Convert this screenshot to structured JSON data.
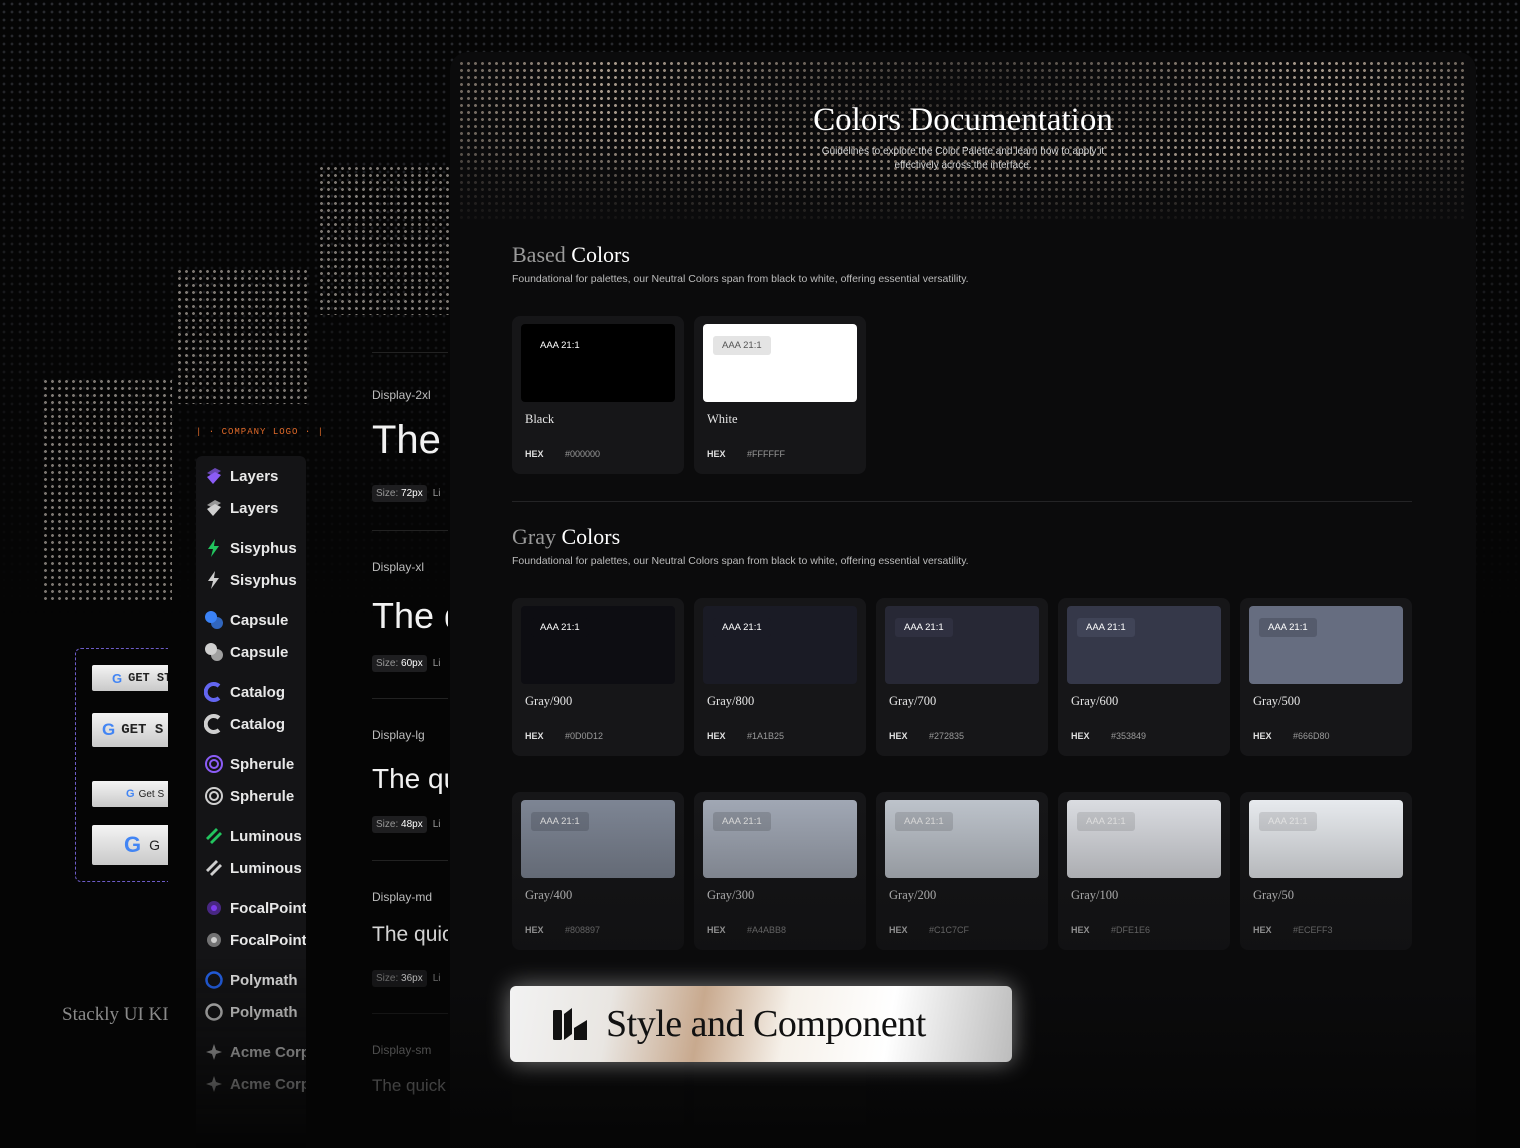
{
  "document": {
    "title": "Colors Documentation",
    "subtitle": "Guidelines to explore the Color Palette and learn how to apply it effectively across the interface."
  },
  "sections": {
    "based": {
      "title_light": "Based",
      "title_strong": "Colors",
      "description": "Foundational for palettes, our Neutral Colors span from black to white, offering essential versatility.",
      "colors": [
        {
          "name": "Black",
          "hex_label": "HEX",
          "hex": "#000000",
          "badge": "AAA 21:1",
          "swatch": "#000000",
          "badge_bg": "#000000",
          "badge_fg": "#ffffff"
        },
        {
          "name": "White",
          "hex_label": "HEX",
          "hex": "#FFFFFF",
          "badge": "AAA 21:1",
          "swatch": "#FFFFFF",
          "badge_bg": "#e4e4e4",
          "badge_fg": "#555555"
        }
      ]
    },
    "gray": {
      "title_light": "Gray",
      "title_strong": "Colors",
      "description": "Foundational for palettes, our Neutral Colors span from black to white, offering essential versatility.",
      "colors": [
        {
          "name": "Gray/900",
          "hex_label": "HEX",
          "hex": "#0D0D12",
          "badge": "AAA 21:1",
          "swatch": "#0D0D12",
          "badge_bg": "#0D0D12",
          "badge_fg": "#ffffff"
        },
        {
          "name": "Gray/800",
          "hex_label": "HEX",
          "hex": "#1A1B25",
          "badge": "AAA 21:1",
          "swatch": "#1A1B25",
          "badge_bg": "#1A1B25",
          "badge_fg": "#ffffff"
        },
        {
          "name": "Gray/700",
          "hex_label": "HEX",
          "hex": "#272835",
          "badge": "AAA 21:1",
          "swatch": "#272835",
          "badge_bg": "#2f3040",
          "badge_fg": "#ffffff"
        },
        {
          "name": "Gray/600",
          "hex_label": "HEX",
          "hex": "#353849",
          "badge": "AAA 21:1",
          "swatch": "#353849",
          "badge_bg": "#404457",
          "badge_fg": "#ffffff"
        },
        {
          "name": "Gray/500",
          "hex_label": "HEX",
          "hex": "#666D80",
          "badge": "AAA 21:1",
          "swatch": "#666D80",
          "badge_bg": "#555b6c",
          "badge_fg": "#ffffff"
        },
        {
          "name": "Gray/400",
          "hex_label": "HEX",
          "hex": "#808897",
          "badge": "AAA 21:1",
          "swatch": "#808897",
          "badge_bg": "#6d7482",
          "badge_fg": "#e8e8e8"
        },
        {
          "name": "Gray/300",
          "hex_label": "HEX",
          "hex": "#A4ABB8",
          "badge": "AAA 21:1",
          "swatch": "#A4ABB8",
          "badge_bg": "#8c929d",
          "badge_fg": "#e8e8e8"
        },
        {
          "name": "Gray/200",
          "hex_label": "HEX",
          "hex": "#C1C7CF",
          "badge": "AAA 21:1",
          "swatch": "#C1C7CF",
          "badge_bg": "#a9aeb5",
          "badge_fg": "#e8e8e8"
        },
        {
          "name": "Gray/100",
          "hex_label": "HEX",
          "hex": "#DFE1E6",
          "badge": "AAA 21:1",
          "swatch": "#DFE1E6",
          "badge_bg": "#c7c9cd",
          "badge_fg": "#f0f0f0"
        },
        {
          "name": "Gray/50",
          "hex_label": "HEX",
          "hex": "#ECEFF3",
          "badge": "AAA 21:1",
          "swatch": "#ECEFF3",
          "badge_bg": "#d2d4d8",
          "badge_fg": "#f4f4f4"
        }
      ]
    }
  },
  "sidebar": {
    "company_logo": "COMPANY LOGO",
    "items": [
      {
        "label": "Layers",
        "icon": "layers-icon",
        "color": "#8b5cf6"
      },
      {
        "label": "Layers",
        "icon": "layers-icon",
        "color": "#cfcfcf"
      },
      {
        "label": "Sisyphus",
        "icon": "bolt-icon",
        "color": "#22c55e"
      },
      {
        "label": "Sisyphus",
        "icon": "bolt-icon",
        "color": "#cfcfcf"
      },
      {
        "label": "Capsule",
        "icon": "capsule-icon",
        "color": "#3b82f6"
      },
      {
        "label": "Capsule",
        "icon": "capsule-icon",
        "color": "#cfcfcf"
      },
      {
        "label": "Catalog",
        "icon": "catalog-icon",
        "color": "#6366f1"
      },
      {
        "label": "Catalog",
        "icon": "catalog-icon",
        "color": "#cfcfcf"
      },
      {
        "label": "Spherule",
        "icon": "sphere-icon",
        "color": "#8b5cf6"
      },
      {
        "label": "Spherule",
        "icon": "sphere-icon",
        "color": "#cfcfcf"
      },
      {
        "label": "Luminous",
        "icon": "luminous-icon",
        "color": "#22c55e"
      },
      {
        "label": "Luminous",
        "icon": "luminous-icon",
        "color": "#cfcfcf"
      },
      {
        "label": "FocalPoint",
        "icon": "focalpoint-icon",
        "color": "#7c3aed"
      },
      {
        "label": "FocalPoint",
        "icon": "focalpoint-icon",
        "color": "#cfcfcf"
      },
      {
        "label": "Polymath",
        "icon": "polymath-icon",
        "color": "#2563eb"
      },
      {
        "label": "Polymath",
        "icon": "polymath-icon",
        "color": "#cfcfcf"
      },
      {
        "label": "Acme Corp",
        "icon": "acme-icon",
        "color": "#cfcfcf"
      },
      {
        "label": "Acme Corp",
        "icon": "acme-icon",
        "color": "#cfcfcf"
      }
    ]
  },
  "typography": [
    {
      "label": "Display-2xl",
      "sample": "The",
      "size_label": "Size:",
      "size": "72px",
      "extra": "Li"
    },
    {
      "label": "Display-xl",
      "sample": "The q",
      "size_label": "Size:",
      "size": "60px",
      "extra": "Li"
    },
    {
      "label": "Display-lg",
      "sample": "The qu",
      "size_label": "Size:",
      "size": "48px",
      "extra": "Li"
    },
    {
      "label": "Display-md",
      "sample": "The quic",
      "size_label": "Size:",
      "size": "36px",
      "extra": "Li"
    },
    {
      "label": "Display-sm",
      "sample": "The quick",
      "size_label": "",
      "size": "",
      "extra": ""
    }
  ],
  "google_buttons": [
    {
      "g": "G",
      "label": "GET ST"
    },
    {
      "g": "G",
      "label": "GET S"
    },
    {
      "g": "G",
      "label": "Get S"
    },
    {
      "g": "G",
      "label": "G"
    }
  ],
  "footer": {
    "stackly": "Stackly UI KIT"
  },
  "banner": {
    "text": "Style and Component",
    "icon": "stackly-logo-icon"
  }
}
